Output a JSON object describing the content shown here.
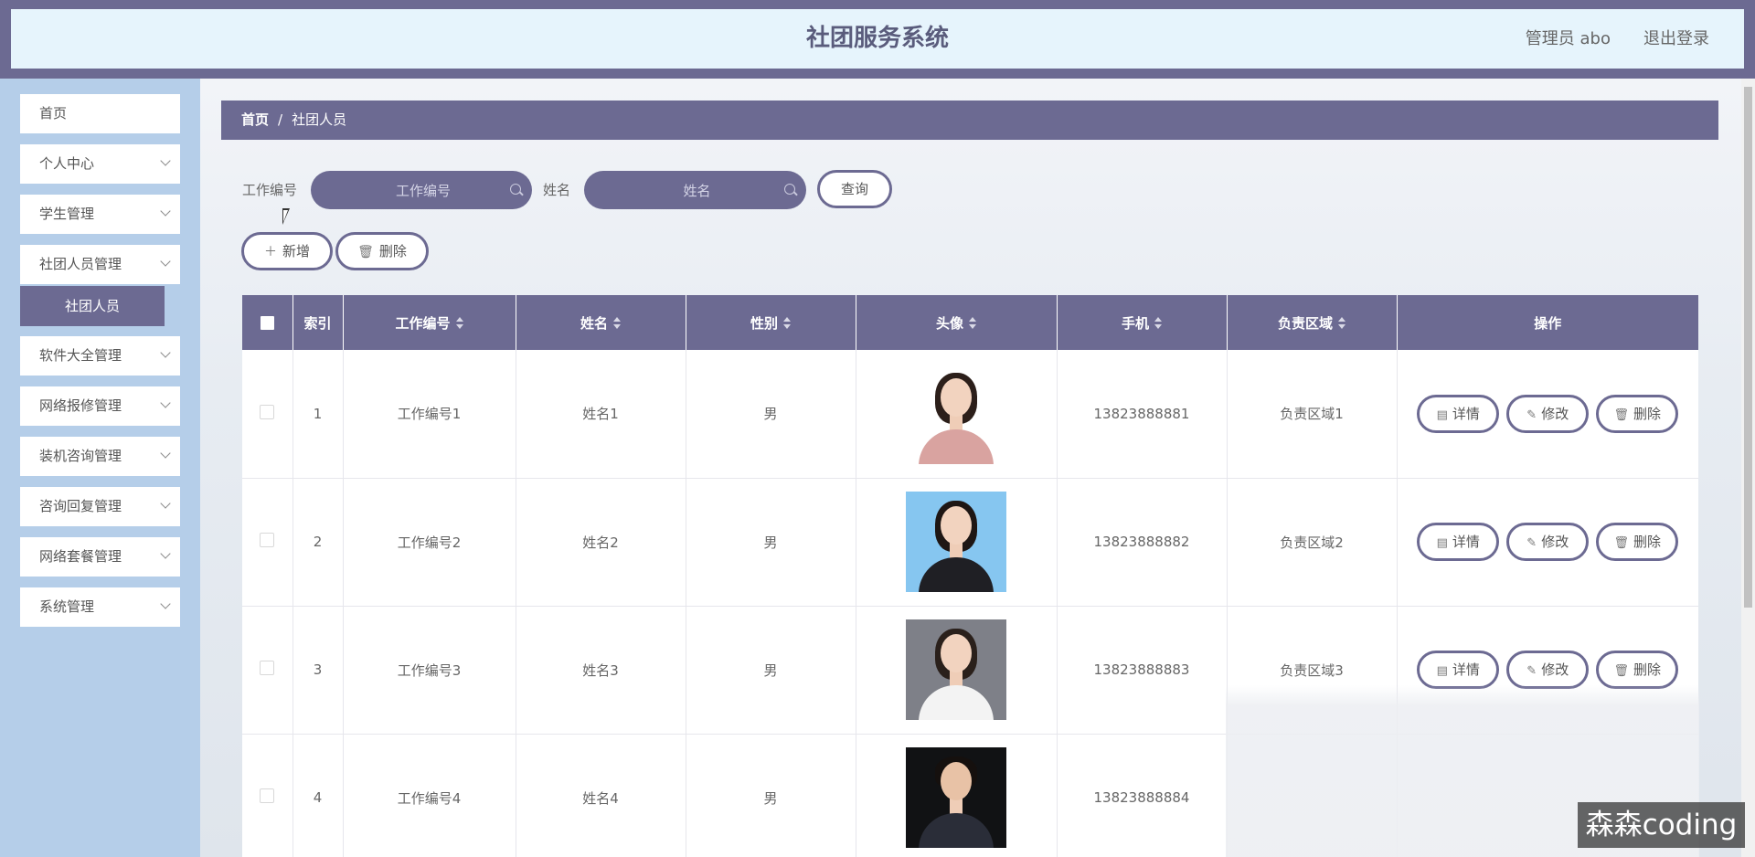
{
  "header": {
    "title": "社团服务系统",
    "user": "管理员 abo",
    "logout": "退出登录"
  },
  "sidebar": {
    "items": [
      {
        "label": "首页"
      },
      {
        "label": "个人中心"
      },
      {
        "label": "学生管理"
      },
      {
        "label": "社团人员管理"
      },
      {
        "label": "软件大全管理"
      },
      {
        "label": "网络报修管理"
      },
      {
        "label": "装机咨询管理"
      },
      {
        "label": "咨询回复管理"
      },
      {
        "label": "网络套餐管理"
      },
      {
        "label": "系统管理"
      }
    ],
    "active_sub": "社团人员"
  },
  "breadcrumb": {
    "home": "首页",
    "sep": "/",
    "current": "社团人员"
  },
  "search": {
    "work_label": "工作编号",
    "work_placeholder": "工作编号",
    "name_label": "姓名",
    "name_placeholder": "姓名",
    "query_label": "查询"
  },
  "actions": {
    "add_label": "新增",
    "delete_label": "删除"
  },
  "table": {
    "headers": [
      "索引",
      "工作编号",
      "姓名",
      "性别",
      "头像",
      "手机",
      "负责区域",
      "操作"
    ],
    "rows": [
      {
        "index": "1",
        "work_id": "工作编号1",
        "name": "姓名1",
        "gender": "男",
        "phone": "13823888881",
        "area": "负责区域1"
      },
      {
        "index": "2",
        "work_id": "工作编号2",
        "name": "姓名2",
        "gender": "男",
        "phone": "13823888882",
        "area": "负责区域2"
      },
      {
        "index": "3",
        "work_id": "工作编号3",
        "name": "姓名3",
        "gender": "男",
        "phone": "13823888883",
        "area": "负责区域3"
      },
      {
        "index": "4",
        "work_id": "工作编号4",
        "name": "姓名4",
        "gender": "男",
        "phone": "13823888884",
        "area": ""
      }
    ],
    "op_labels": {
      "detail": "详情",
      "edit": "修改",
      "delete": "删除"
    }
  },
  "watermark": "森森coding",
  "colors": {
    "accent": "#6c6a92",
    "sidebar_bg": "#b5cee9",
    "header_bg": "#e6f4fc"
  }
}
